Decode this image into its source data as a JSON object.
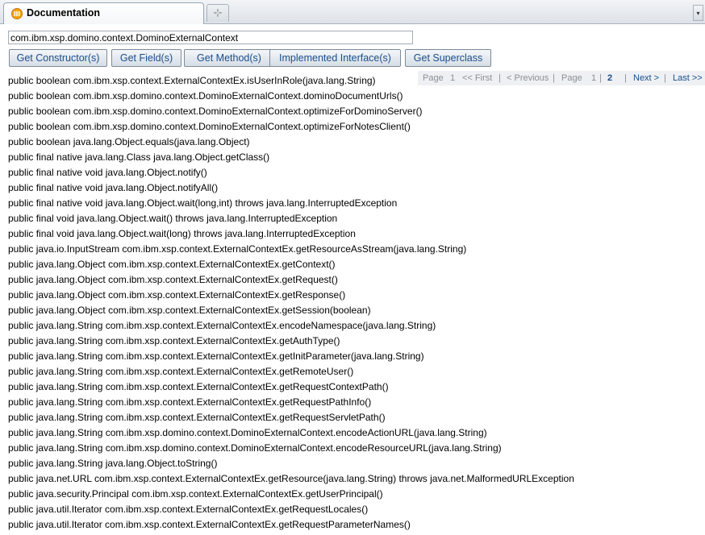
{
  "tab": {
    "title": "Documentation",
    "new_tab_glyph": "⊹",
    "dropdown_glyph": "▾"
  },
  "search": {
    "value": "com.ibm.xsp.domino.context.DominoExternalContext"
  },
  "buttons": [
    "Get Constructor(s)",
    "Get Field(s)",
    "Get Method(s)",
    "Implemented Interface(s)",
    "Get Superclass"
  ],
  "pager": {
    "page_label": "Page",
    "page_one": "1",
    "first": "<< First",
    "previous": "< Previous",
    "page_label_2": "Page",
    "page_1": "1",
    "page_2": "2",
    "next": "Next >",
    "last": "Last >>",
    "sep": "|"
  },
  "methods": [
    "public boolean com.ibm.xsp.context.ExternalContextEx.isUserInRole(java.lang.String)",
    "public boolean com.ibm.xsp.domino.context.DominoExternalContext.dominoDocumentUrls()",
    "public boolean com.ibm.xsp.domino.context.DominoExternalContext.optimizeForDominoServer()",
    "public boolean com.ibm.xsp.domino.context.DominoExternalContext.optimizeForNotesClient()",
    "public boolean java.lang.Object.equals(java.lang.Object)",
    "public final native java.lang.Class java.lang.Object.getClass()",
    "public final native void java.lang.Object.notify()",
    "public final native void java.lang.Object.notifyAll()",
    "public final native void java.lang.Object.wait(long,int) throws java.lang.InterruptedException",
    "public final void java.lang.Object.wait() throws java.lang.InterruptedException",
    "public final void java.lang.Object.wait(long) throws java.lang.InterruptedException",
    "public java.io.InputStream com.ibm.xsp.context.ExternalContextEx.getResourceAsStream(java.lang.String)",
    "public java.lang.Object com.ibm.xsp.context.ExternalContextEx.getContext()",
    "public java.lang.Object com.ibm.xsp.context.ExternalContextEx.getRequest()",
    "public java.lang.Object com.ibm.xsp.context.ExternalContextEx.getResponse()",
    "public java.lang.Object com.ibm.xsp.context.ExternalContextEx.getSession(boolean)",
    "public java.lang.String com.ibm.xsp.context.ExternalContextEx.encodeNamespace(java.lang.String)",
    "public java.lang.String com.ibm.xsp.context.ExternalContextEx.getAuthType()",
    "public java.lang.String com.ibm.xsp.context.ExternalContextEx.getInitParameter(java.lang.String)",
    "public java.lang.String com.ibm.xsp.context.ExternalContextEx.getRemoteUser()",
    "public java.lang.String com.ibm.xsp.context.ExternalContextEx.getRequestContextPath()",
    "public java.lang.String com.ibm.xsp.context.ExternalContextEx.getRequestPathInfo()",
    "public java.lang.String com.ibm.xsp.context.ExternalContextEx.getRequestServletPath()",
    "public java.lang.String com.ibm.xsp.domino.context.DominoExternalContext.encodeActionURL(java.lang.String)",
    "public java.lang.String com.ibm.xsp.domino.context.DominoExternalContext.encodeResourceURL(java.lang.String)",
    "public java.lang.String java.lang.Object.toString()",
    "public java.net.URL com.ibm.xsp.context.ExternalContextEx.getResource(java.lang.String) throws java.net.MalformedURLException",
    "public java.security.Principal com.ibm.xsp.context.ExternalContextEx.getUserPrincipal()",
    "public java.util.Iterator com.ibm.xsp.context.ExternalContextEx.getRequestLocales()",
    "public java.util.Iterator com.ibm.xsp.context.ExternalContextEx.getRequestParameterNames()"
  ]
}
